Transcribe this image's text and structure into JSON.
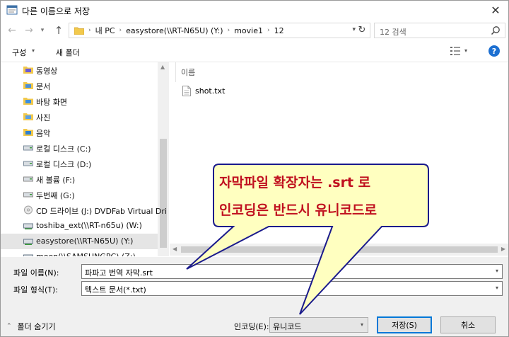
{
  "window": {
    "title": "다른 이름으로 저장"
  },
  "address": {
    "crumbs": [
      "내 PC",
      "easystore(\\\\RT-N65U) (Y:)",
      "movie1",
      "12"
    ],
    "search_placeholder": "12 검색"
  },
  "toolbar": {
    "organize": "구성",
    "new_folder": "새 폴더"
  },
  "nav": {
    "items": [
      {
        "label": "동영상",
        "icon": "video-folder-icon"
      },
      {
        "label": "문서",
        "icon": "documents-folder-icon"
      },
      {
        "label": "바탕 화면",
        "icon": "desktop-folder-icon"
      },
      {
        "label": "사진",
        "icon": "pictures-folder-icon"
      },
      {
        "label": "음악",
        "icon": "music-folder-icon"
      },
      {
        "label": "로컬 디스크 (C:)",
        "icon": "local-disk-icon"
      },
      {
        "label": "로컬 디스크 (D:)",
        "icon": "local-disk-icon"
      },
      {
        "label": "새 볼륨 (F:)",
        "icon": "drive-icon"
      },
      {
        "label": "두번째 (G:)",
        "icon": "drive-icon"
      },
      {
        "label": "CD 드라이브 (J:) DVDFab Virtual Dri",
        "icon": "cd-drive-icon"
      },
      {
        "label": "toshiba_ext(\\\\RT-n65u) (W:)",
        "icon": "network-drive-icon"
      },
      {
        "label": "easystore(\\\\RT-N65U) (Y:)",
        "icon": "network-drive-icon",
        "selected": true
      },
      {
        "label": "moon(\\\\SAMSUNGPC) (Z:)",
        "icon": "network-drive-icon"
      }
    ]
  },
  "files": {
    "column_name": "이름",
    "items": [
      {
        "name": "shot.txt"
      }
    ]
  },
  "form": {
    "filename_label": "파일 이름(N):",
    "filename_value": "파파고 번역 자막.srt",
    "filetype_label": "파일 형식(T):",
    "filetype_value": "텍스트 문서(*.txt)",
    "hide_folders": "폴더 숨기기",
    "encoding_label": "인코딩(E):",
    "encoding_value": "유니코드",
    "save_button": "저장(S)",
    "cancel_button": "취소"
  },
  "callout": {
    "line1": "자막파일 확장자는 .srt 로",
    "line2": "인코딩은 반드시  유니코드로",
    "fill": "#ffffc0",
    "border": "#1a1a8c",
    "text_color": "#c0101f"
  }
}
